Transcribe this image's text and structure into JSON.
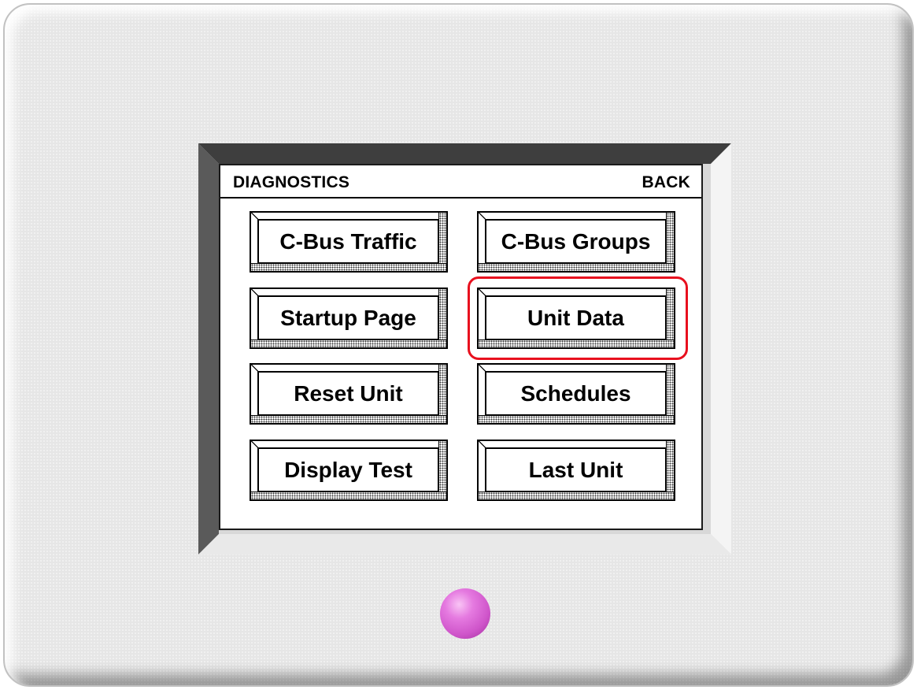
{
  "screen": {
    "title": "DIAGNOSTICS",
    "back_label": "BACK",
    "buttons": [
      {
        "label": "C-Bus Traffic"
      },
      {
        "label": "C-Bus Groups"
      },
      {
        "label": "Startup Page"
      },
      {
        "label": "Unit Data",
        "highlighted": true
      },
      {
        "label": "Reset Unit"
      },
      {
        "label": "Schedules"
      },
      {
        "label": "Display Test"
      },
      {
        "label": "Last Unit"
      }
    ]
  },
  "colors": {
    "highlight": "#e8101e",
    "indicator_led": "#e57ae0",
    "panel": "#e6e6e6"
  }
}
